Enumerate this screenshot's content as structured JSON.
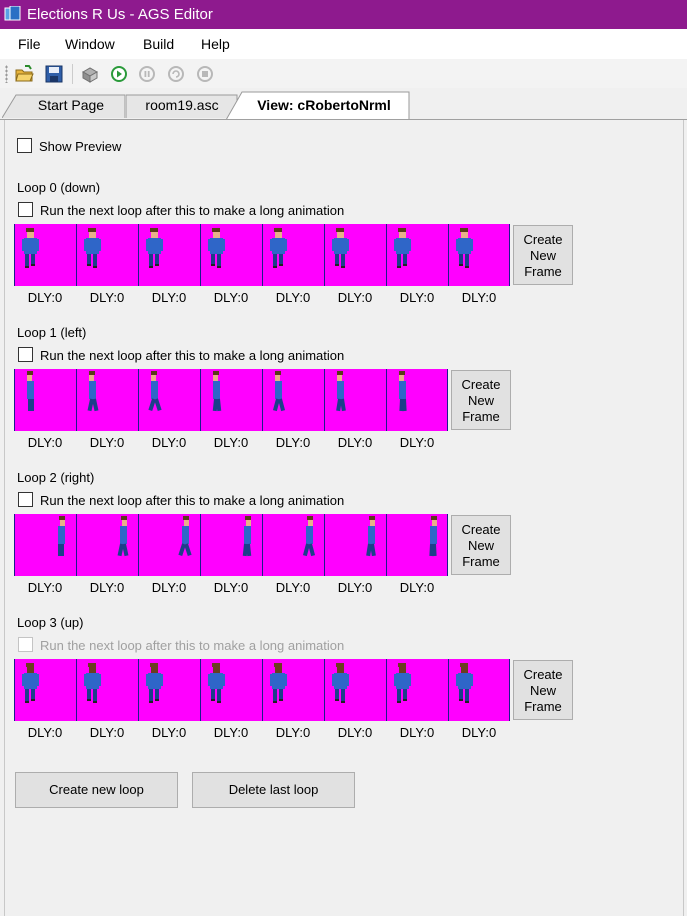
{
  "window": {
    "title": "Elections R Us - AGS Editor",
    "accent": "#8e1a8e"
  },
  "menu": [
    "File",
    "Window",
    "Build",
    "Help"
  ],
  "toolbar": [
    "open-folder-icon",
    "save-icon",
    "build-icon",
    "run-icon",
    "pause-icon",
    "step-icon",
    "stop-icon"
  ],
  "tabs": [
    {
      "label": "Start Page",
      "active": false
    },
    {
      "label": "room19.asc",
      "active": false
    },
    {
      "label": "View: cRobertoNrml",
      "active": true
    }
  ],
  "editor": {
    "show_preview_label": "Show Preview",
    "create_frame_label": "Create New Frame",
    "frame_background": "#ff00ff",
    "loops": [
      {
        "title": "Loop 0 (down)",
        "run_next_label": "Run the next loop after this to make a long animation",
        "run_next_enabled": true,
        "direction": "down",
        "frames": [
          "DLY:0",
          "DLY:0",
          "DLY:0",
          "DLY:0",
          "DLY:0",
          "DLY:0",
          "DLY:0",
          "DLY:0"
        ]
      },
      {
        "title": "Loop 1 (left)",
        "run_next_label": "Run the next loop after this to make a long animation",
        "run_next_enabled": true,
        "direction": "left",
        "frames": [
          "DLY:0",
          "DLY:0",
          "DLY:0",
          "DLY:0",
          "DLY:0",
          "DLY:0",
          "DLY:0"
        ]
      },
      {
        "title": "Loop 2 (right)",
        "run_next_label": "Run the next loop after this to make a long animation",
        "run_next_enabled": true,
        "direction": "right",
        "frames": [
          "DLY:0",
          "DLY:0",
          "DLY:0",
          "DLY:0",
          "DLY:0",
          "DLY:0",
          "DLY:0"
        ]
      },
      {
        "title": "Loop 3 (up)",
        "run_next_label": "Run the next loop after this to make a long animation",
        "run_next_enabled": false,
        "direction": "up",
        "frames": [
          "DLY:0",
          "DLY:0",
          "DLY:0",
          "DLY:0",
          "DLY:0",
          "DLY:0",
          "DLY:0",
          "DLY:0"
        ]
      }
    ],
    "create_loop_label": "Create new loop",
    "delete_loop_label": "Delete last loop"
  }
}
